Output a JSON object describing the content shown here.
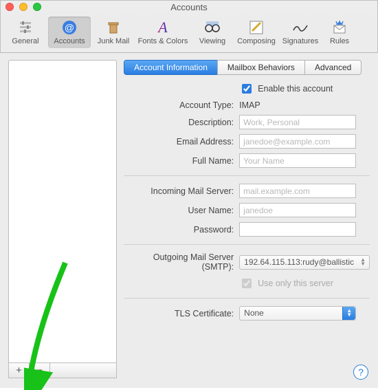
{
  "window": {
    "title": "Accounts"
  },
  "toolbar": {
    "items": [
      {
        "label": "General"
      },
      {
        "label": "Accounts"
      },
      {
        "label": "Junk Mail"
      },
      {
        "label": "Fonts & Colors"
      },
      {
        "label": "Viewing"
      },
      {
        "label": "Composing"
      },
      {
        "label": "Signatures"
      },
      {
        "label": "Rules"
      }
    ],
    "active_index": 1
  },
  "tabs": {
    "items": [
      {
        "label": "Account Information"
      },
      {
        "label": "Mailbox Behaviors"
      },
      {
        "label": "Advanced"
      }
    ],
    "active_index": 0
  },
  "form": {
    "enable_label": "Enable this account",
    "enable_checked": true,
    "account_type_label": "Account Type:",
    "account_type_value": "IMAP",
    "description_label": "Description:",
    "description_placeholder": "Work, Personal",
    "description_value": "",
    "email_label": "Email Address:",
    "email_placeholder": "janedoe@example.com",
    "email_value": "",
    "fullname_label": "Full Name:",
    "fullname_placeholder": "Your Name",
    "fullname_value": "",
    "incoming_label": "Incoming Mail Server:",
    "incoming_placeholder": "mail.example.com",
    "incoming_value": "",
    "username_label": "User Name:",
    "username_placeholder": "janedoe",
    "username_value": "",
    "password_label": "Password:",
    "password_value": "",
    "smtp_label": "Outgoing Mail Server (SMTP):",
    "smtp_value": "192.64.115.113:rudy@ballistic",
    "use_only_label": "Use only this server",
    "use_only_checked": true,
    "tls_label": "TLS Certificate:",
    "tls_value": "None"
  },
  "sidebar": {
    "add_label": "+",
    "remove_label": "−"
  },
  "help": {
    "label": "?"
  }
}
